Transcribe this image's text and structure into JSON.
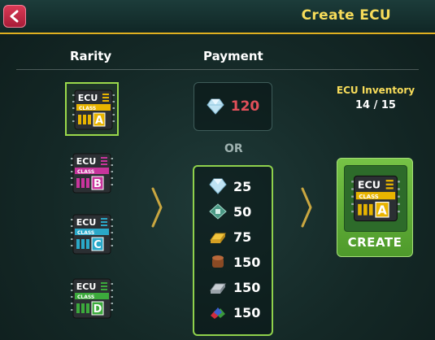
{
  "header": {
    "title": "Create ECU",
    "back_icon": "back-arrow-icon"
  },
  "columns": {
    "rarity": "Rarity",
    "payment": "Payment"
  },
  "rarities": [
    {
      "grade": "A",
      "label": "ECU",
      "class": "CLASS",
      "color": "#e8b400",
      "selected": true
    },
    {
      "grade": "B",
      "label": "ECU",
      "class": "CLASS",
      "color": "#c8349c",
      "selected": false
    },
    {
      "grade": "C",
      "label": "ECU",
      "class": "CLASS",
      "color": "#2aa8c8",
      "selected": false
    },
    {
      "grade": "D",
      "label": "ECU",
      "class": "CLASS",
      "color": "#3caa3c",
      "selected": false
    }
  ],
  "payment": {
    "single": {
      "icon": "diamond-icon",
      "value": "120"
    },
    "or_label": "OR",
    "multi": [
      {
        "icon": "diamond-icon",
        "value": "25"
      },
      {
        "icon": "circuit-chip-icon",
        "value": "50"
      },
      {
        "icon": "gold-bar-icon",
        "value": "75"
      },
      {
        "icon": "copper-icon",
        "value": "150"
      },
      {
        "icon": "silver-bar-icon",
        "value": "150"
      },
      {
        "icon": "gems-icon",
        "value": "150"
      }
    ]
  },
  "inventory": {
    "label": "ECU Inventory",
    "count": "14 / 15"
  },
  "create": {
    "label": "CREATE",
    "preview_grade": "A",
    "preview_label": "ECU",
    "preview_class": "CLASS"
  },
  "colors": {
    "accent_gold": "#f7dc5a",
    "selected_green": "#8fd14c",
    "cost_red": "#e2505a"
  }
}
